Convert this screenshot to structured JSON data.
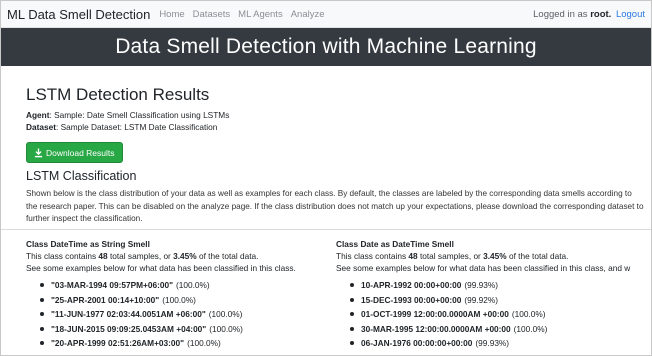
{
  "navbar": {
    "brand": "ML Data Smell Detection",
    "links": [
      "Home",
      "Datasets",
      "ML Agents",
      "Analyze"
    ],
    "login_prefix": "Logged in as",
    "username": "root.",
    "logout": "Logout"
  },
  "banner": {
    "title": "Data Smell Detection with Machine Learning"
  },
  "results": {
    "title": "LSTM Detection Results",
    "agent_label": "Agent",
    "agent_value": ": Sample: Date Smell Classification using LSTMs",
    "dataset_label": "Dataset",
    "dataset_value": ": Sample Dataset: LSTM Date Classification",
    "download_label": "Download Results",
    "section_title": "LSTM Classification",
    "description": "Shown below is the class distribution of your data as well as examples for each class. By default, the classes are labeled by the corresponding data smells according to the research paper. This can be disabled on the analyze page. If the class distribution does not match up your expectations, please download the corresponding dataset to further inspect the classification."
  },
  "classes": [
    {
      "name": "Class DateTime as String Smell",
      "stats_prefix": "This class contains ",
      "total": "48",
      "stats_mid": " total samples, or ",
      "percent": "3.45%",
      "stats_suffix": " of the total data.",
      "help": "See some examples below for what data has been classified in this class.",
      "examples": [
        {
          "sample": "\"03-MAR-1994 09:57PM+06:00\"",
          "confidence": "(100.0%)"
        },
        {
          "sample": "\"25-APR-2001 00:14+10:00\"",
          "confidence": "(100.0%)"
        },
        {
          "sample": "\"11-JUN-1977 02:03:44.0051AM +06:00\"",
          "confidence": "(100.0%)"
        },
        {
          "sample": "\"18-JUN-2015 09:09:25.0453AM +04:00\"",
          "confidence": "(100.0%)"
        },
        {
          "sample": "\"20-APR-1999 02:51:26AM+03:00\"",
          "confidence": "(100.0%)"
        }
      ]
    },
    {
      "name": "Class Date as DateTime Smell",
      "stats_prefix": "This class contains ",
      "total": "48",
      "stats_mid": " total samples, or ",
      "percent": "3.45%",
      "stats_suffix": " of the total data.",
      "help": "See some examples below for what data has been classified in this class, and w",
      "examples": [
        {
          "sample": "10-APR-1992 00:00+00:00",
          "confidence": "(99.93%)"
        },
        {
          "sample": "15-DEC-1993 00:00+00:00",
          "confidence": "(99.92%)"
        },
        {
          "sample": "01-OCT-1999 12:00:00.0000AM +00:00",
          "confidence": "(100.0%)"
        },
        {
          "sample": "30-MAR-1995 12:00:00.0000AM +00:00",
          "confidence": "(100.0%)"
        },
        {
          "sample": "06-JAN-1976 00:00:00+00:00",
          "confidence": "(99.93%)"
        }
      ]
    }
  ],
  "colors": {
    "navbar_bg": "#f8f9fa",
    "banner_bg": "#343a40",
    "download_button": "#28a745",
    "logout_link": "#2a7ae2"
  },
  "icons": {
    "download": "download-icon",
    "bullet": "bullet-icon"
  }
}
